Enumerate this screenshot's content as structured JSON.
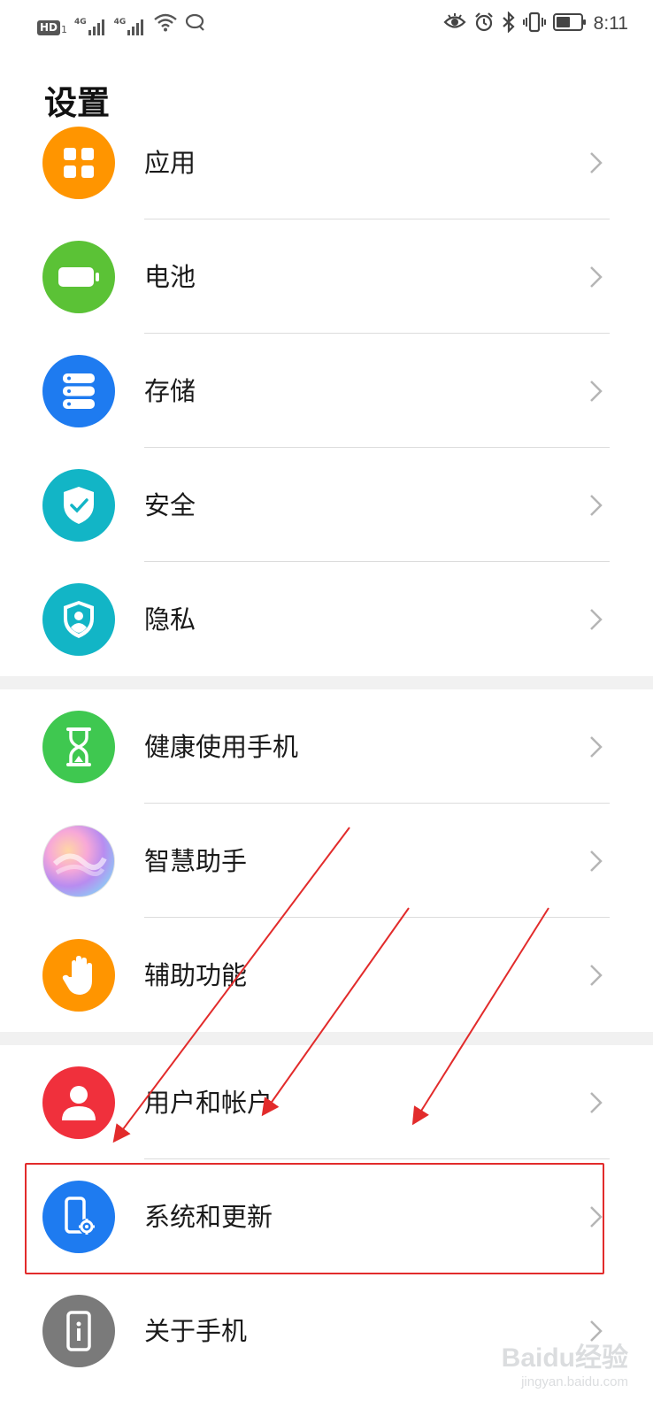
{
  "status_bar": {
    "hd_label": "HD",
    "hd_sub": "1",
    "signal1_label": "4G",
    "signal2_label": "4G",
    "time": "8:11",
    "icons": [
      "eye-comfort-icon",
      "alarm-icon",
      "bluetooth-icon",
      "vibrate-icon",
      "battery-icon"
    ]
  },
  "header": {
    "title": "设置"
  },
  "sections": [
    {
      "items": [
        {
          "label": "应用",
          "icon": "apps-grid-icon",
          "color": "#FF9500"
        },
        {
          "label": "电池",
          "icon": "battery-icon",
          "color": "#5BC236"
        },
        {
          "label": "存储",
          "icon": "storage-icon",
          "color": "#1E7BF0"
        },
        {
          "label": "安全",
          "icon": "shield-check-icon",
          "color": "#12B5C6"
        },
        {
          "label": "隐私",
          "icon": "privacy-shield-icon",
          "color": "#12B5C6"
        }
      ]
    },
    {
      "items": [
        {
          "label": "健康使用手机",
          "icon": "hourglass-icon",
          "color": "#3FC850"
        },
        {
          "label": "智慧助手",
          "icon": "assistant-orb-icon",
          "color": "#C9A0E8"
        },
        {
          "label": "辅助功能",
          "icon": "hand-icon",
          "color": "#FF9500"
        }
      ]
    },
    {
      "items": [
        {
          "label": "用户和帐户",
          "icon": "user-icon",
          "color": "#F0303C"
        },
        {
          "label": "系统和更新",
          "icon": "system-update-icon",
          "color": "#1E7BF0"
        },
        {
          "label": "关于手机",
          "icon": "phone-info-icon",
          "color": "#7A7A7A"
        }
      ]
    }
  ],
  "annotation": {
    "highlight_color": "#E22B2B",
    "highlighted_item": "系统和更新"
  },
  "watermark": {
    "main": "Baidu经验",
    "sub": "jingyan.baidu.com"
  }
}
